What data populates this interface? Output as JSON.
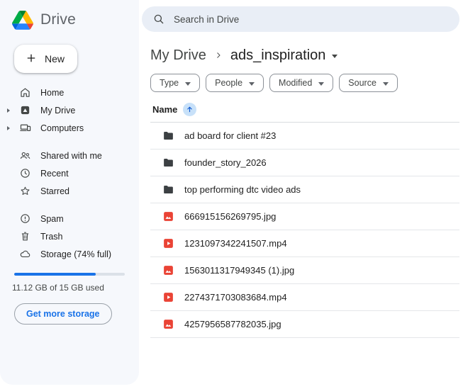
{
  "app": {
    "title": "Drive"
  },
  "search": {
    "placeholder": "Search in Drive",
    "icon": "search-icon"
  },
  "sidebar": {
    "new_button_label": "New",
    "sections": [
      {
        "items": [
          {
            "label": "Home",
            "icon": "home-icon",
            "expandable": false
          },
          {
            "label": "My Drive",
            "icon": "my-drive-icon",
            "expandable": true
          },
          {
            "label": "Computers",
            "icon": "computers-icon",
            "expandable": true
          }
        ]
      },
      {
        "items": [
          {
            "label": "Shared with me",
            "icon": "shared-with-me-icon",
            "expandable": false
          },
          {
            "label": "Recent",
            "icon": "recent-icon",
            "expandable": false
          },
          {
            "label": "Starred",
            "icon": "starred-icon",
            "expandable": false
          }
        ]
      },
      {
        "items": [
          {
            "label": "Spam",
            "icon": "spam-icon",
            "expandable": false
          },
          {
            "label": "Trash",
            "icon": "trash-icon",
            "expandable": false
          },
          {
            "label": "Storage (74% full)",
            "icon": "storage-icon",
            "expandable": false
          }
        ]
      }
    ],
    "storage": {
      "percent_full": 74,
      "usage_text": "11.12 GB of 15 GB used",
      "button_label": "Get more storage"
    }
  },
  "breadcrumb": {
    "root": "My Drive",
    "current": "ads_inspiration"
  },
  "filters": [
    "Type",
    "People",
    "Modified",
    "Source"
  ],
  "file_list": {
    "header": "Name",
    "sort": "ascending",
    "rows": [
      {
        "name": "ad board for client #23",
        "type": "folder"
      },
      {
        "name": "founder_story_2026",
        "type": "folder"
      },
      {
        "name": "top performing dtc video ads",
        "type": "folder"
      },
      {
        "name": "666915156269795.jpg",
        "type": "image"
      },
      {
        "name": "1231097342241507.mp4",
        "type": "video"
      },
      {
        "name": "1563011317949345 (1).jpg",
        "type": "image"
      },
      {
        "name": "2274371703083684.mp4",
        "type": "video"
      },
      {
        "name": "4257956587782035.jpg",
        "type": "image"
      }
    ]
  },
  "colors": {
    "accent_blue": "#1a73e8",
    "sort_badge_blue": "#c8e1f9",
    "file_icon_red": "#ea4335",
    "folder_icon_gray": "#3c4043",
    "sidebar_bg": "#f6f8fc",
    "search_bg": "#e9eef6"
  }
}
